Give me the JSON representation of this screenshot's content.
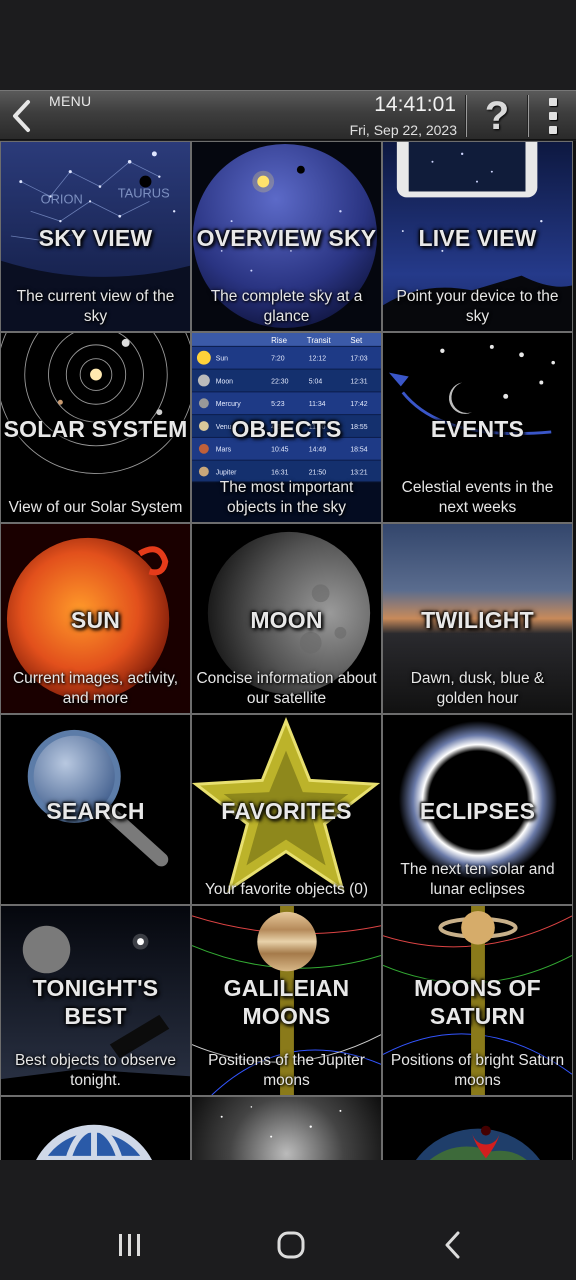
{
  "header": {
    "menu_label": "MENU",
    "time": "14:41:01",
    "date": "Fri, Sep 22, 2023",
    "help_glyph": "?"
  },
  "tiles": [
    {
      "title": "SKY VIEW",
      "desc": "The current view of the sky",
      "art": "sky-chart-art"
    },
    {
      "title": "OVERVIEW SKY",
      "desc": "The complete sky at a glance",
      "art": "sky-dome-art"
    },
    {
      "title": "LIVE VIEW",
      "desc": "Point your device to the sky",
      "art": "phone-sky-art"
    },
    {
      "title": "SOLAR SYSTEM",
      "desc": "View of our Solar System",
      "art": "orbits-art"
    },
    {
      "title": "OBJECTS",
      "desc": "The most important objects in the sky",
      "art": "object-table-art"
    },
    {
      "title": "EVENTS",
      "desc": "Celestial events in the next weeks",
      "art": "events-art"
    },
    {
      "title": "SUN",
      "desc": "Current images, activity, and more",
      "art": "sun-art"
    },
    {
      "title": "MOON",
      "desc": "Concise information about our satellite",
      "art": "moon-art"
    },
    {
      "title": "TWILIGHT",
      "desc": "Dawn, dusk, blue & golden hour",
      "art": "twilight-art"
    },
    {
      "title": "SEARCH",
      "desc": "",
      "art": "magnifier-art"
    },
    {
      "title": "FAVORITES",
      "desc": "Your favorite objects (0)",
      "art": "star-art"
    },
    {
      "title": "ECLIPSES",
      "desc": "The next ten solar and lunar eclipses",
      "art": "eclipse-art"
    },
    {
      "title": "TONIGHT'S BEST",
      "desc": "Best objects to observe tonight.",
      "art": "telescope-art"
    },
    {
      "title": "GALILEIAN MOONS",
      "desc": "Positions of the Jupiter moons",
      "art": "jupiter-art"
    },
    {
      "title": "MOONS OF SATURN",
      "desc": "Positions of bright Saturn moons",
      "art": "saturn-art"
    },
    {
      "title": "",
      "desc": "",
      "art": "globe-art"
    },
    {
      "title": "",
      "desc": "",
      "art": "milky-way-art"
    },
    {
      "title": "",
      "desc": "",
      "art": "earth-location-art"
    }
  ],
  "objects_table": {
    "headers": [
      "Rise",
      "Transit",
      "Set"
    ],
    "rows": [
      {
        "name": "Sun",
        "rise": "7:20",
        "transit": "12:12",
        "set": "17:03"
      },
      {
        "name": "Moon",
        "rise": "22:30",
        "transit": "5:04",
        "set": "12:31"
      },
      {
        "name": "Mercury",
        "rise": "5:23",
        "transit": "11:34",
        "set": "17:42"
      },
      {
        "name": "Venus",
        "rise": "4:51",
        "transit": "11:00",
        "set": "18:55"
      },
      {
        "name": "Mars",
        "rise": "10:45",
        "transit": "14:49",
        "set": "18:54"
      },
      {
        "name": "Jupiter",
        "rise": "16:31",
        "transit": "21:50",
        "set": "13:21"
      }
    ]
  },
  "sky_labels": {
    "orion": "ORION",
    "taurus": "TAURUS"
  },
  "colors": {
    "topbar": "#3e3e3e",
    "tile_border": "#6d6d6d",
    "background": "#1c1c1e"
  }
}
